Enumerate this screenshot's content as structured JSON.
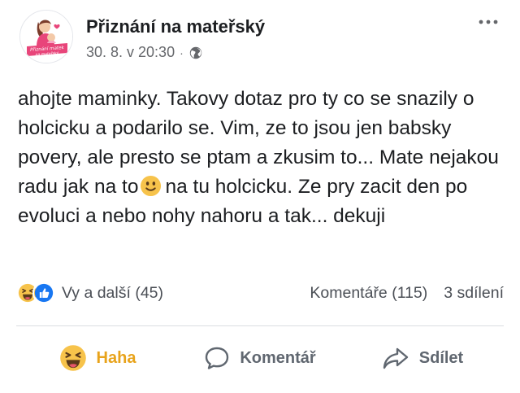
{
  "post": {
    "page_name": "Přiznání na mateřský",
    "avatar_text": [
      "Přiznání matek",
      "na mateřský"
    ],
    "date": "30. 8. v 20:30",
    "separator": "·",
    "privacy_icon": "globe-icon",
    "more_icon": "more-options-icon",
    "text_part1": "ahojte maminky. Takovy dotaz pro ty co se snazily o holcicku a podarilo se. Vim, ze to jsou jen babsky povery, ale presto se ptam a zkusim to... Mate nejakou radu jak na to",
    "inline_emoji": "slightly-smiling-face-icon",
    "text_part2": "na tu holcicku. Ze pry zacit den po evoluci a nebo nohy nahoru a tak... dekuji"
  },
  "stats": {
    "reaction_icons": [
      "haha-icon",
      "like-icon"
    ],
    "reactions_label": "Vy a další (45)",
    "comments_label": "Komentáře (115)",
    "shares_label": "3 sdílení"
  },
  "actions": {
    "reaction": {
      "label": "Haha",
      "icon": "haha-icon",
      "color": "#e8a31b"
    },
    "comment": {
      "label": "Komentář",
      "icon": "comment-icon"
    },
    "share": {
      "label": "Sdílet",
      "icon": "share-icon"
    }
  },
  "colors": {
    "text": "#1c1e21",
    "secondary": "#65676b",
    "like_blue": "#1877f2",
    "haha_yellow": "#f7c34b",
    "avatar_pink": "#e8457a"
  }
}
